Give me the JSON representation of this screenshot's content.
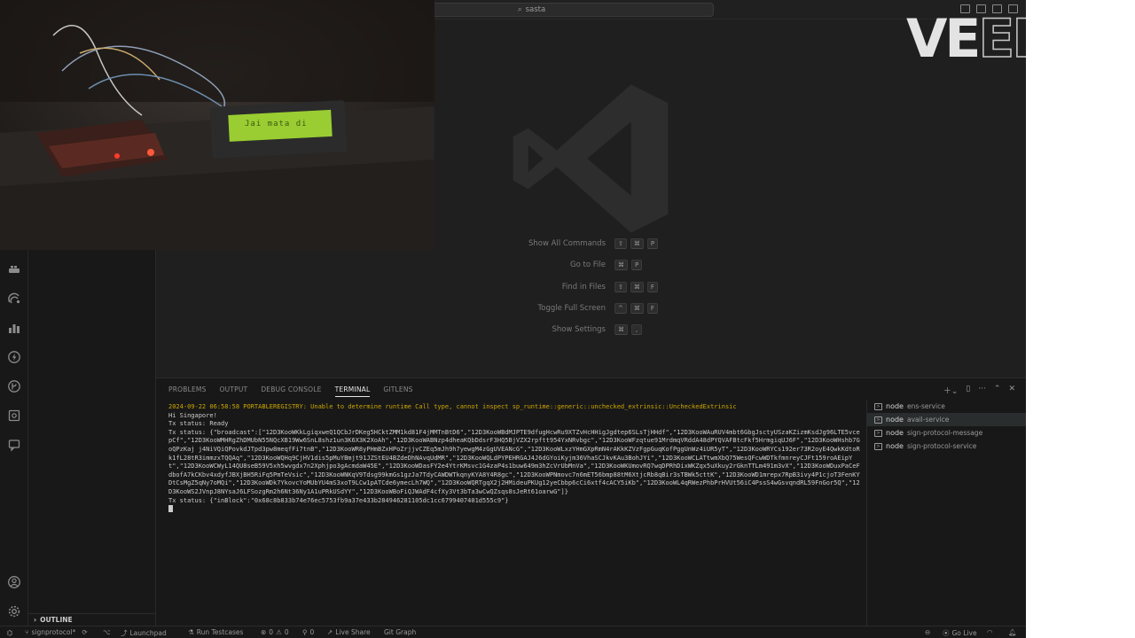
{
  "titlebar": {
    "search_text": "sasta"
  },
  "editor": {
    "shortcuts": [
      {
        "label": "Show All Commands",
        "keys": [
          "⇧",
          "⌘",
          "P"
        ]
      },
      {
        "label": "Go to File",
        "keys": [
          "⌘",
          "P"
        ]
      },
      {
        "label": "Find in Files",
        "keys": [
          "⇧",
          "⌘",
          "F"
        ]
      },
      {
        "label": "Toggle Full Screen",
        "keys": [
          "^",
          "⌘",
          "F"
        ]
      },
      {
        "label": "Show Settings",
        "keys": [
          "⌘",
          ","
        ]
      }
    ]
  },
  "panel": {
    "tabs": [
      "PROBLEMS",
      "OUTPUT",
      "DEBUG CONSOLE",
      "TERMINAL",
      "GITLENS"
    ],
    "active_tab": "TERMINAL",
    "terminal_lines": [
      {
        "text": "2024-09-22 06:58:58 PORTABLEREGISTRY: Unable to determine runtime Call type, cannot inspect sp_runtime::generic::unchecked_extrinsic::UncheckedExtrinsic",
        "kind": "warn"
      },
      {
        "text": "Hi Singapore!",
        "kind": "normal"
      },
      {
        "text": "Tx status: Ready",
        "kind": "normal"
      },
      {
        "text": "Tx status: {\"broadcast\":[\"12D3KooWKkLgiqxweQ1QCbJrDKeg5HCktZMM1kd81F4jMMTnBtD6\",\"12D3KooWBdMJPTE9dfugHcwRu9XTZvHcHHigJgdtep6SLsTjHHdf\",\"12D3KooWAuRUV4mbt6GbgJsctyUSzaKZizmKsdJg96LTE5vcepCf\",\"12D3KooWMHRgZhDMUbN55NQcXB19Ww6SnL8shz1un3K6X3K2XoAh\",\"12D3KooWABNzp4dheaKQbDdsrF3HQ5BjVZX2rpftt954YxNRvbgc\",\"12D3KooWFzqtue91MrdmqVRddA48dPYQVAFBtcFkf5HrmgiqUJ6F\",\"12D3KooWHshb7GoQPzKaj j4NiVQiQPovkdJTpd3pw8meqfFi7tnB\",\"12D3KooWR8yPHmBZxHPoZrjjvCZEq5mJh9h7yewgM4zGgUVEANcG\",\"12D3KooWLxzYHmGXpRmN4rAKkKZVzFgpGuqKofPggUnWz4iUR5yT\",\"12D3KooWRYCs192er73R2oyE4QwkKdtoRk1fL28tR3immzxTQQAq\",\"12D3KooWQHq9CjHV1dis5pMuYBmjt91JZStEU4BZdeDhNAvqUdMR\",\"12D3KooWQLdPYPEHRGAJ4J6dGYoiKyjm36VhaSCJkvKAu3BohJYi\",\"12D3KooWCLATtwmXbQ75WesQFcwWDTkfmnreyCJFt159roAEipYt\",\"12D3KooWCWyL14QU8seB59V5xh5wvgdx7n2Xphjpo3gAcmdaW45E\",\"12D3KooWDasFY2e4YtrKMsvc1G4zaP4s1buw649m3hZcVrUbMnVa\",\"12D3KooWKUmovRQ7wqDPRhDixWKZqx5uXkuy2rGknTTLm491m3vX\",\"12D3KooWDuxPaCeFdbofA7kCKbv4xdyfJBXjBH5RiFq5PmTeVsic\",\"12D3KooWNKqV9Tdsg99kmGs1gzJa7TdyCAWDWTkqnyKYA8Y4R8gc\",\"12D3KooWPNmovc7n6mET56bmp88tM6XtjcRb8qBir3sTBWk5cttK\",\"12D3KooWD1mrepx7RpB3ivy4P1cjoT3FenKYDtCsMgZ5qNy7oMQi\",\"12D3KooWDk7YkovcYoMUbYU4mS3xoT9LCw1pATCde6ymecLh7WQ\",\"12D3KooWQRTgqX2j2HMideuPKUg12yeCbbp6cCi6xtf4cACY5iKb\",\"12D3KooWL4qRWezPhbPrHVUt56iC4PssS4wGsvqndRL59FnGor5Q\",\"12D3KooWS2JVnpJ8NYsaJ6LFSozgRm2h6Nt36Ny1A1uPRkUSdYY\",\"12D3KooWBoFiQJWAdF4cfXy3Vt3bTa3wCwQZsqs8sJeRt61oarwG\"]}",
        "kind": "normal"
      },
      {
        "text": "Tx status: {\"inBlock\":\"0x68c8b833b74e76ec5753fb9a37e433b284946281105dc1cc6799407401d555c9\"}",
        "kind": "normal"
      }
    ],
    "terminals": [
      {
        "node": "node",
        "name": "ens-service",
        "active": false
      },
      {
        "node": "node",
        "name": "avail-service",
        "active": true
      },
      {
        "node": "node",
        "name": "sign-protocol-message",
        "active": false
      },
      {
        "node": "node",
        "name": "sign-protocol-service",
        "active": false
      }
    ]
  },
  "sidebar": {
    "outline_label": "OUTLINE"
  },
  "statusbar": {
    "branch": "signprotocol*",
    "launchpad": "Launchpad",
    "run_testcases": "Run Testcases",
    "errors": "0",
    "warnings": "0",
    "ports": "0",
    "live_share": "Live Share",
    "git_graph": "Git Graph",
    "go_live": "Go Live"
  },
  "webcam": {
    "lcd_text": "Jai mata di"
  },
  "watermark": {
    "brand_main": "VE",
    "brand_ghost": "ED"
  },
  "colors": {
    "warn": "#cca700",
    "lcd": "#9acd32",
    "accent": "#e7e7e7"
  }
}
